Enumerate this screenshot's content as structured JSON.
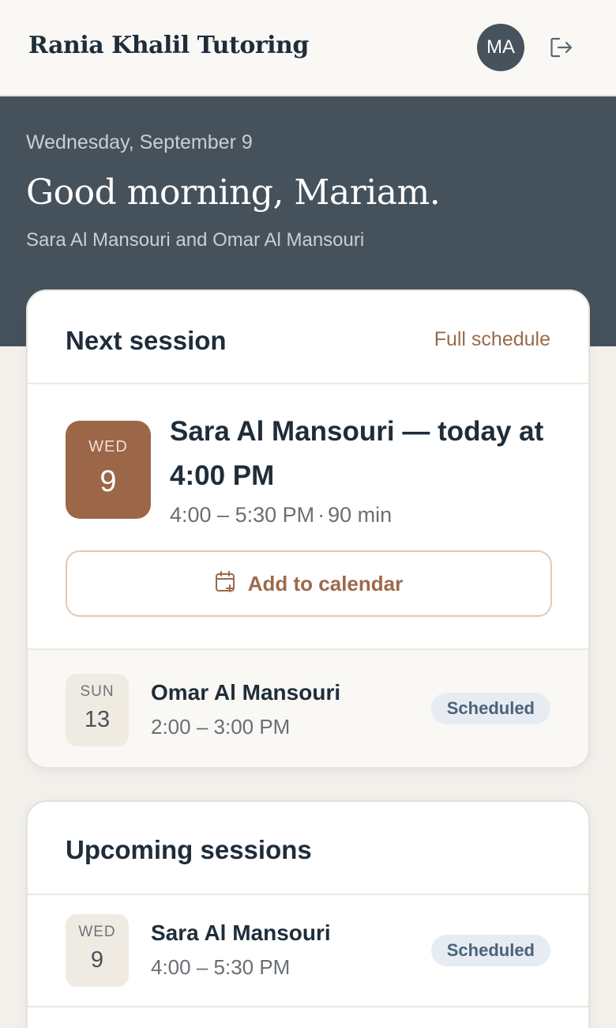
{
  "header": {
    "brand": "Rania Khalil Tutoring",
    "avatar_initials": "MA",
    "logout_icon": "logout-icon"
  },
  "hero": {
    "date": "Wednesday, September 9",
    "greeting": "Good morning, Mariam.",
    "students": "Sara Al Mansouri and Omar Al Mansouri"
  },
  "next_session": {
    "title": "Next session",
    "link": "Full schedule",
    "featured": {
      "dow": "WED",
      "day": "9",
      "headline": "Sara Al Mansouri — today at 4:00 PM",
      "time": "4:00 – 5:30 PM",
      "separator": "·",
      "duration": "90 min",
      "add_to_calendar": "Add to calendar"
    },
    "following": {
      "dow": "SUN",
      "day": "13",
      "student": "Omar Al Mansouri",
      "time": "2:00 – 3:00 PM",
      "status": "Scheduled"
    }
  },
  "upcoming": {
    "title": "Upcoming sessions",
    "items": [
      {
        "dow": "WED",
        "day": "9",
        "student": "Sara Al Mansouri",
        "time": "4:00 – 5:30 PM",
        "status": "Scheduled"
      }
    ]
  },
  "colors": {
    "hero_bg": "#45525c",
    "accent": "#9b6748",
    "badge_bg": "#e6ecf1",
    "badge_text": "#4a6379"
  }
}
